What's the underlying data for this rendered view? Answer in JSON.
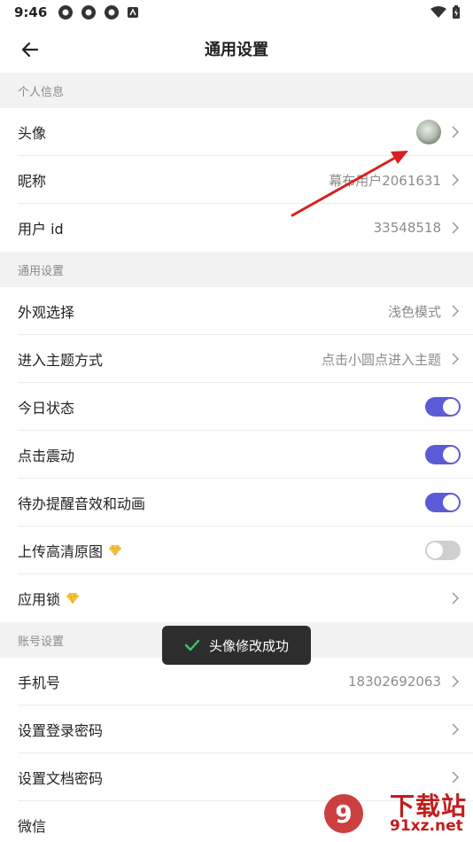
{
  "status_bar": {
    "time": "9:46"
  },
  "app_bar": {
    "title": "通用设置"
  },
  "sections": {
    "personal": {
      "title": "个人信息",
      "avatar_label": "头像",
      "nickname_label": "昵称",
      "nickname_value": "幕布用户2061631",
      "userid_label": "用户 id",
      "userid_value": "33548518"
    },
    "general": {
      "title": "通用设置",
      "appearance_label": "外观选择",
      "appearance_value": "浅色模式",
      "enter_topic_label": "进入主题方式",
      "enter_topic_value": "点击小圆点进入主题",
      "today_status_label": "今日状态",
      "today_status_on": true,
      "vibrate_label": "点击震动",
      "vibrate_on": true,
      "todo_sound_label": "待办提醒音效和动画",
      "todo_sound_on": true,
      "upload_hd_label": "上传高清原图",
      "upload_hd_on": false,
      "app_lock_label": "应用锁"
    },
    "account": {
      "title": "账号设置",
      "phone_label": "手机号",
      "phone_value": "18302692063",
      "login_pwd_label": "设置登录密码",
      "doc_pwd_label": "设置文档密码",
      "wechat_label": "微信"
    }
  },
  "toast": {
    "text": "头像修改成功"
  },
  "watermark": {
    "text": "下载站",
    "sub": "91xz.net"
  },
  "colors": {
    "accent": "#5b5bd6",
    "annotation_arrow": "#d92020"
  }
}
